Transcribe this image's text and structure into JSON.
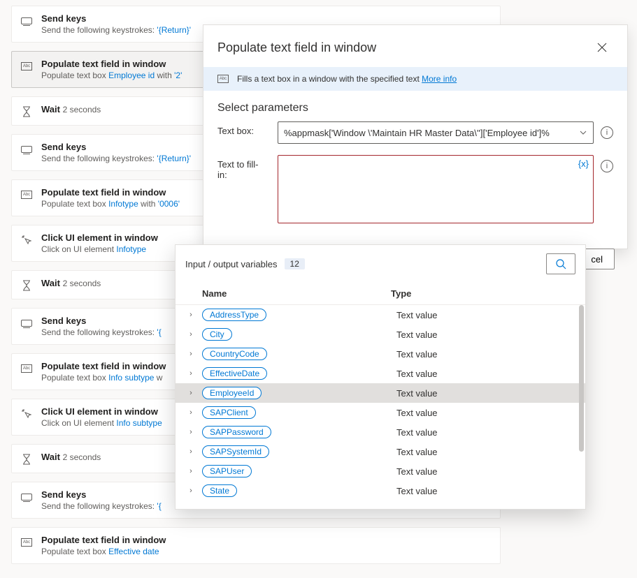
{
  "flow_steps": [
    {
      "icon": "keyboard",
      "title": "Send keys",
      "sub_prefix": "Send the following keystrokes: ",
      "sub_value": "'{Return}'",
      "selected": false
    },
    {
      "icon": "abc",
      "title": "Populate text field in window",
      "sub_prefix": "Populate text box ",
      "sub_link": "Employee id",
      "sub_middle": " with ",
      "sub_value": "'2'",
      "selected": true
    },
    {
      "icon": "hourglass",
      "title": "Wait",
      "sub_inline_value": "2",
      "sub_inline_suffix": " seconds",
      "selected": false
    },
    {
      "icon": "keyboard",
      "title": "Send keys",
      "sub_prefix": "Send the following keystrokes: ",
      "sub_value": "'{Return}'",
      "selected": false
    },
    {
      "icon": "abc",
      "title": "Populate text field in window",
      "sub_prefix": "Populate text box ",
      "sub_link": "Infotype",
      "sub_middle": " with ",
      "sub_value": "'0006'",
      "selected": false
    },
    {
      "icon": "click",
      "title": "Click UI element in window",
      "sub_prefix": "Click on UI element ",
      "sub_link": "Infotype",
      "selected": false
    },
    {
      "icon": "hourglass",
      "title": "Wait",
      "sub_inline_value": "2",
      "sub_inline_suffix": " seconds",
      "selected": false
    },
    {
      "icon": "keyboard",
      "title": "Send keys",
      "sub_prefix": "Send the following keystrokes: ",
      "sub_value": "'{",
      "selected": false
    },
    {
      "icon": "abc",
      "title": "Populate text field in window",
      "sub_prefix": "Populate text box ",
      "sub_link": "Info subtype",
      "sub_middle": " w",
      "selected": false
    },
    {
      "icon": "click",
      "title": "Click UI element in window",
      "sub_prefix": "Click on UI element ",
      "sub_link": "Info subtype",
      "selected": false
    },
    {
      "icon": "hourglass",
      "title": "Wait",
      "sub_inline_value": "2",
      "sub_inline_suffix": " seconds",
      "selected": false
    },
    {
      "icon": "keyboard",
      "title": "Send keys",
      "sub_prefix": "Send the following keystrokes: ",
      "sub_value": "'{",
      "selected": false
    },
    {
      "icon": "abc",
      "title": "Populate text field in window",
      "sub_prefix": "Populate text box ",
      "sub_link": "Effective date",
      "sub_middle": " ",
      "selected": false
    }
  ],
  "dialog": {
    "title": "Populate text field in window",
    "info_text": "Fills a text box in a window with the specified text ",
    "info_link": "More info",
    "section_heading": "Select parameters",
    "label_textbox": "Text box:",
    "textbox_value": "%appmask['Window \\'Maintain HR Master Data\\'']['Employee id']%",
    "label_fillin": "Text to fill-in:",
    "fillin_value": "",
    "fx_label": "{x}",
    "cancel_label": "cel"
  },
  "var_popover": {
    "header_label": "Input / output variables",
    "count": "12",
    "col_name": "Name",
    "col_type": "Type",
    "rows": [
      {
        "name": "AddressType",
        "type": "Text value",
        "selected": false
      },
      {
        "name": "City",
        "type": "Text value",
        "selected": false
      },
      {
        "name": "CountryCode",
        "type": "Text value",
        "selected": false
      },
      {
        "name": "EffectiveDate",
        "type": "Text value",
        "selected": false
      },
      {
        "name": "EmployeeId",
        "type": "Text value",
        "selected": true
      },
      {
        "name": "SAPClient",
        "type": "Text value",
        "selected": false
      },
      {
        "name": "SAPPassword",
        "type": "Text value",
        "selected": false
      },
      {
        "name": "SAPSystemId",
        "type": "Text value",
        "selected": false
      },
      {
        "name": "SAPUser",
        "type": "Text value",
        "selected": false
      },
      {
        "name": "State",
        "type": "Text value",
        "selected": false
      }
    ]
  }
}
